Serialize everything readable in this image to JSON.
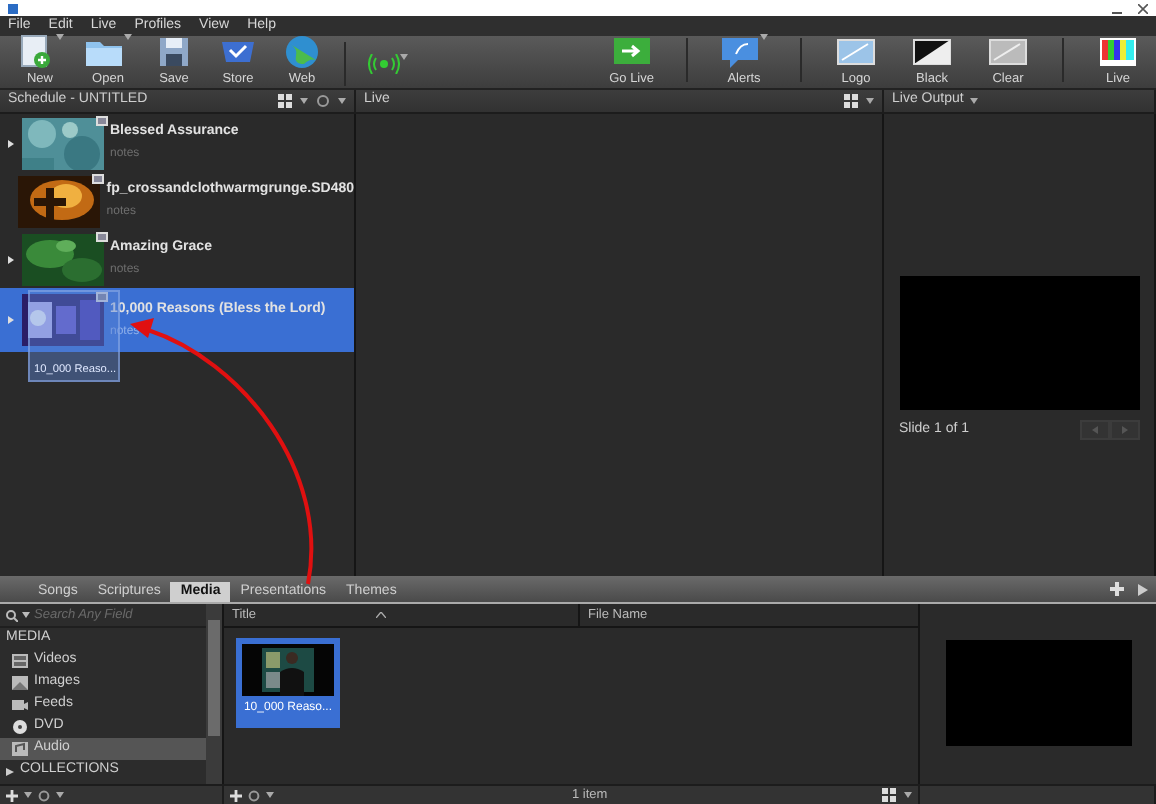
{
  "menu": [
    "File",
    "Edit",
    "Live",
    "Profiles",
    "View",
    "Help"
  ],
  "toolbar_left": [
    {
      "label": "New",
      "has_menu": true
    },
    {
      "label": "Open",
      "has_menu": true
    },
    {
      "label": "Save",
      "has_menu": false
    },
    {
      "label": "Store",
      "has_menu": false
    },
    {
      "label": "Web",
      "has_menu": false
    }
  ],
  "broadcast": {
    "has_menu": true
  },
  "toolbar_right": [
    {
      "label": "Go Live",
      "has_menu": false
    },
    {
      "label": "Alerts",
      "has_menu": true
    },
    {
      "label": "Logo",
      "has_menu": false
    },
    {
      "label": "Black",
      "has_menu": false
    },
    {
      "label": "Clear",
      "has_menu": false
    },
    {
      "label": "Live",
      "has_menu": false
    }
  ],
  "schedule": {
    "title": "Schedule - UNTITLED",
    "items": [
      {
        "title": "Blessed Assurance",
        "notes": "notes",
        "expandable": true,
        "selected": false
      },
      {
        "title": "fp_crossandclothwarmgrunge.SD480",
        "notes": "notes",
        "expandable": false,
        "selected": false
      },
      {
        "title": "Amazing Grace",
        "notes": "notes",
        "expandable": true,
        "selected": false
      },
      {
        "title": "10,000 Reasons (Bless the Lord)",
        "notes": "notes",
        "expandable": true,
        "selected": true
      }
    ]
  },
  "drag_preview": {
    "label": "10_000 Reaso..."
  },
  "live": {
    "title": "Live"
  },
  "live_output": {
    "title": "Live Output",
    "slide_label": "Slide 1 of 1"
  },
  "tabs": [
    {
      "label": "Songs",
      "selected": false
    },
    {
      "label": "Scriptures",
      "selected": false
    },
    {
      "label": "Media",
      "selected": true
    },
    {
      "label": "Presentations",
      "selected": false
    },
    {
      "label": "Themes",
      "selected": false
    }
  ],
  "library": {
    "search": {
      "placeholder": "Search Any Field"
    },
    "tree": [
      {
        "label": "MEDIA",
        "children": [
          {
            "label": "Videos",
            "selected": false
          },
          {
            "label": "Images",
            "selected": false
          },
          {
            "label": "Feeds",
            "selected": false
          },
          {
            "label": "DVD",
            "selected": false
          },
          {
            "label": "Audio",
            "selected": true
          }
        ]
      },
      {
        "label": "COLLECTIONS",
        "expanded": false
      }
    ],
    "columns": [
      "Title",
      "File Name"
    ],
    "items": [
      {
        "label": "10_000 Reaso...",
        "selected": true
      }
    ],
    "status": "1 item"
  }
}
